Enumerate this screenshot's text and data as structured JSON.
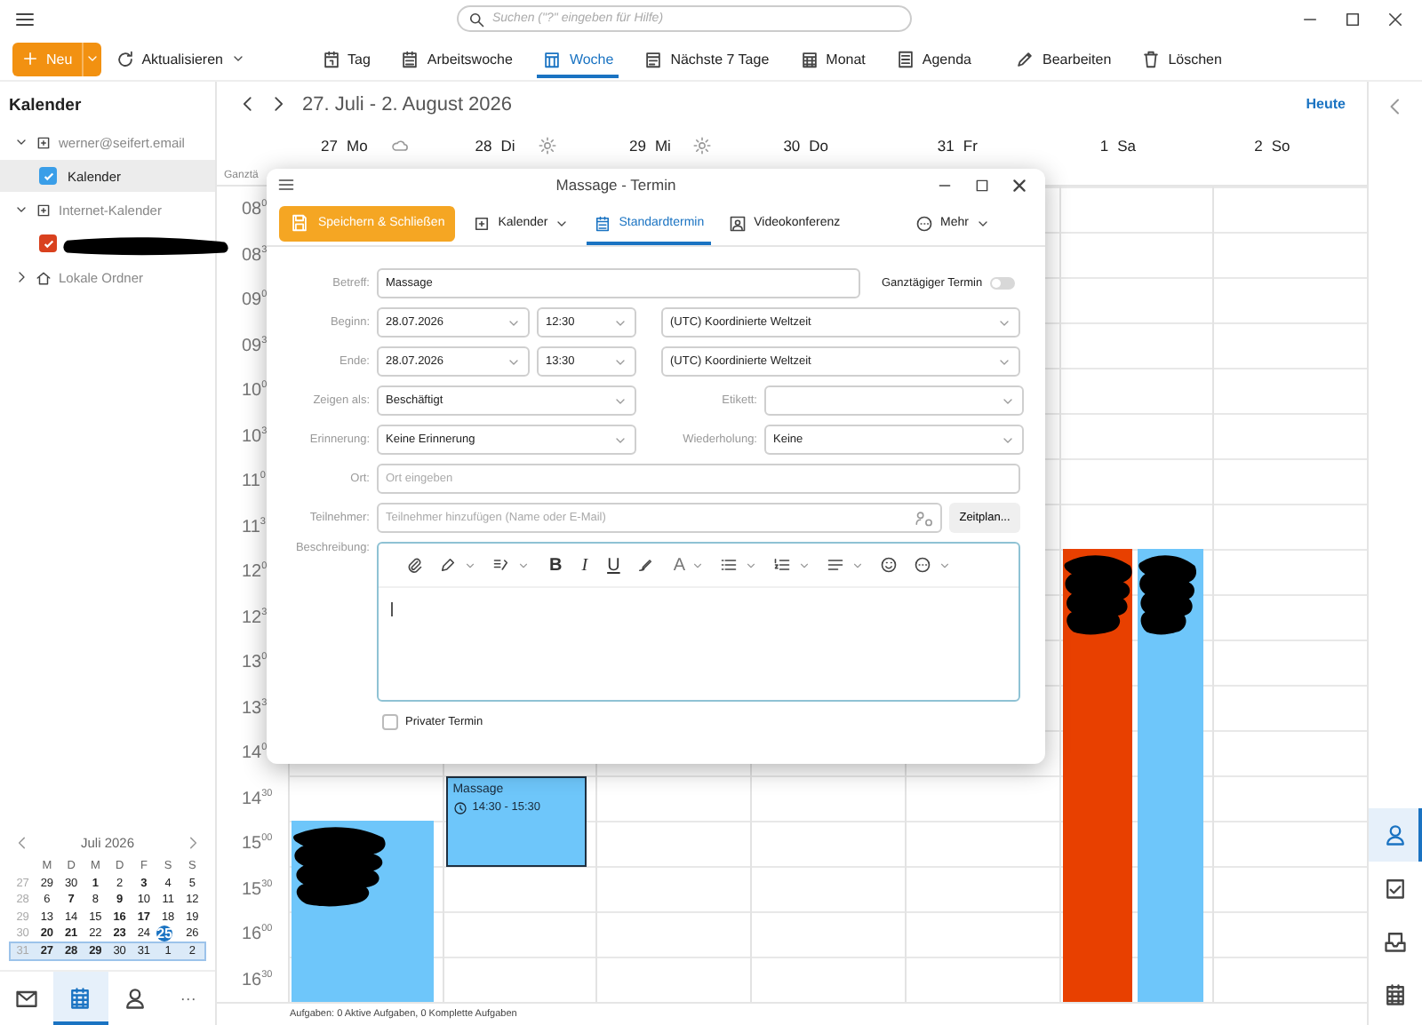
{
  "search": {
    "placeholder": "Suchen (\"?\" eingeben für Hilfe)"
  },
  "toolbar": {
    "new_button": "Neu",
    "refresh": "Aktualisieren",
    "views": [
      {
        "label": "Tag",
        "kind": "day",
        "selected": false
      },
      {
        "label": "Arbeitswoche",
        "kind": "workweek",
        "selected": false
      },
      {
        "label": "Woche",
        "kind": "week",
        "selected": true
      },
      {
        "label": "Nächste 7 Tage",
        "kind": "next7",
        "selected": false
      },
      {
        "label": "Monat",
        "kind": "month",
        "selected": false
      },
      {
        "label": "Agenda",
        "kind": "agenda",
        "selected": false
      }
    ],
    "actions": [
      {
        "label": "Bearbeiten",
        "kind": "edit"
      },
      {
        "label": "Löschen",
        "kind": "delete"
      }
    ]
  },
  "sidebar": {
    "title": "Kalender",
    "tree": [
      {
        "label": "werner@seifert.email",
        "kind": "account",
        "expanded": true,
        "children": [
          {
            "label": "Kalender",
            "checked": true,
            "selected": true,
            "color": "#3a9ee8"
          }
        ]
      },
      {
        "label": "Internet-Kalender",
        "kind": "account",
        "expanded": true,
        "children": [
          {
            "checked": true,
            "selected": false,
            "color": "#d9411e",
            "redacted": true
          }
        ]
      },
      {
        "label": "Lokale Ordner",
        "kind": "local",
        "expanded": false
      }
    ]
  },
  "minical": {
    "month": "Juli 2026",
    "weekdays": [
      "M",
      "D",
      "M",
      "D",
      "F",
      "S",
      "S"
    ],
    "weeks": [
      {
        "week": "27",
        "selected": false,
        "days": [
          {
            "d": "29",
            "bold": false,
            "today": false
          },
          {
            "d": "30",
            "bold": false,
            "today": false
          },
          {
            "d": "1",
            "bold": true,
            "today": false
          },
          {
            "d": "2",
            "bold": false,
            "today": false
          },
          {
            "d": "3",
            "bold": true,
            "today": false
          },
          {
            "d": "4",
            "bold": false,
            "today": false
          },
          {
            "d": "5",
            "bold": false,
            "today": false
          }
        ]
      },
      {
        "week": "28",
        "selected": false,
        "days": [
          {
            "d": "6",
            "bold": false,
            "today": false
          },
          {
            "d": "7",
            "bold": true,
            "today": false
          },
          {
            "d": "8",
            "bold": false,
            "today": false
          },
          {
            "d": "9",
            "bold": true,
            "today": false
          },
          {
            "d": "10",
            "bold": false,
            "today": false
          },
          {
            "d": "11",
            "bold": false,
            "today": false
          },
          {
            "d": "12",
            "bold": false,
            "today": false
          }
        ]
      },
      {
        "week": "29",
        "selected": false,
        "days": [
          {
            "d": "13",
            "bold": false,
            "today": false
          },
          {
            "d": "14",
            "bold": false,
            "today": false
          },
          {
            "d": "15",
            "bold": false,
            "today": false
          },
          {
            "d": "16",
            "bold": true,
            "today": false
          },
          {
            "d": "17",
            "bold": true,
            "today": false
          },
          {
            "d": "18",
            "bold": false,
            "today": false
          },
          {
            "d": "19",
            "bold": false,
            "today": false
          }
        ]
      },
      {
        "week": "30",
        "selected": false,
        "days": [
          {
            "d": "20",
            "bold": true,
            "today": false
          },
          {
            "d": "21",
            "bold": true,
            "today": false
          },
          {
            "d": "22",
            "bold": false,
            "today": false
          },
          {
            "d": "23",
            "bold": true,
            "today": false
          },
          {
            "d": "24",
            "bold": false,
            "today": false
          },
          {
            "d": "25",
            "bold": false,
            "today": true
          },
          {
            "d": "26",
            "bold": false,
            "today": false
          }
        ]
      },
      {
        "week": "31",
        "selected": true,
        "days": [
          {
            "d": "27",
            "bold": true,
            "today": false
          },
          {
            "d": "28",
            "bold": true,
            "today": false
          },
          {
            "d": "29",
            "bold": true,
            "today": false
          },
          {
            "d": "30",
            "bold": false,
            "today": false
          },
          {
            "d": "31",
            "bold": false,
            "today": false
          },
          {
            "d": "1",
            "bold": false,
            "today": false
          },
          {
            "d": "2",
            "bold": false,
            "today": false
          }
        ]
      }
    ]
  },
  "bottom_nav": [
    {
      "kind": "mail",
      "selected": false
    },
    {
      "kind": "calendar",
      "selected": true
    },
    {
      "kind": "contacts",
      "selected": false
    },
    {
      "kind": "more",
      "label": "···",
      "selected": false
    }
  ],
  "calendar": {
    "range": "27. Juli - 2. August 2026",
    "today_button": "Heute",
    "allday_label": "Ganztä",
    "days": [
      {
        "num": "27",
        "name": "Mo",
        "weather": {
          "kind": "cloud"
        },
        "events": [
          {
            "kind": "full",
            "color": "#6ec6fa",
            "selected": false,
            "redacted": true
          }
        ]
      },
      {
        "num": "28",
        "name": "Di",
        "weather": {
          "kind": "sun"
        },
        "events": [
          {
            "title": "Massage",
            "time": "14:30 - 15:30",
            "kind": "full",
            "color": "#6ec6fa",
            "selected": true
          }
        ]
      },
      {
        "num": "29",
        "name": "Mi",
        "weather": {
          "kind": "sun"
        }
      },
      {
        "num": "30",
        "name": "Do"
      },
      {
        "num": "31",
        "name": "Fr"
      },
      {
        "num": "1",
        "name": "Sa",
        "events": [
          {
            "kind": "left",
            "color": "#e84000",
            "selected": false,
            "redacted": true
          },
          {
            "kind": "right",
            "color": "#6ec6fa",
            "selected": false,
            "redacted": true
          }
        ]
      },
      {
        "num": "2",
        "name": "So"
      }
    ],
    "times": [
      {
        "hour": "08",
        "minute": "0"
      },
      {
        "hour": "08",
        "minute": "3"
      },
      {
        "hour": "09",
        "minute": "0"
      },
      {
        "hour": "09",
        "minute": "3"
      },
      {
        "hour": "10",
        "minute": "0"
      },
      {
        "hour": "10",
        "minute": "3"
      },
      {
        "hour": "11",
        "minute": "0"
      },
      {
        "hour": "11",
        "minute": "3"
      },
      {
        "hour": "12",
        "minute": "0"
      },
      {
        "hour": "12",
        "minute": "3"
      },
      {
        "hour": "13",
        "minute": "0"
      },
      {
        "hour": "13",
        "minute": "3"
      },
      {
        "hour": "14",
        "minute": "0"
      },
      {
        "hour": "14",
        "minute": "30"
      },
      {
        "hour": "15",
        "minute": "00"
      },
      {
        "hour": "15",
        "minute": "30"
      },
      {
        "hour": "16",
        "minute": "00"
      },
      {
        "hour": "16",
        "minute": "30"
      }
    ]
  },
  "status_bar": "Aufgaben: 0 Aktive Aufgaben, 0 Komplette Aufgaben",
  "rail": [
    {
      "kind": "contacts",
      "selected": true
    },
    {
      "kind": "tasks",
      "selected": false
    },
    {
      "kind": "inbox",
      "selected": false
    },
    {
      "kind": "calendar",
      "selected": false
    }
  ],
  "dialog": {
    "title": "Massage - Termin",
    "save": "Speichern & Schließen",
    "calendar_menu": "Kalender",
    "tabs": [
      {
        "label": "Standardtermin",
        "kind": "standard",
        "selected": true
      },
      {
        "label": "Videokonferenz",
        "kind": "video",
        "selected": false
      }
    ],
    "more": "Mehr",
    "subject": {
      "label": "Betreff:",
      "value": "Massage"
    },
    "allday": {
      "label": "Ganztägiger Termin",
      "on": false
    },
    "start": {
      "label": "Beginn:",
      "date": "28.07.2026",
      "time": "12:30",
      "tz": "(UTC) Koordinierte Weltzeit"
    },
    "end": {
      "label": "Ende:",
      "date": "28.07.2026",
      "time": "13:30",
      "tz": "(UTC) Koordinierte Weltzeit"
    },
    "show_as": {
      "label": "Zeigen als:",
      "value": "Beschäftigt"
    },
    "tag": {
      "label": "Etikett:"
    },
    "reminder": {
      "label": "Erinnerung:",
      "value": "Keine Erinnerung"
    },
    "repeat": {
      "label": "Wiederholung:",
      "value": "Keine"
    },
    "location": {
      "label": "Ort:",
      "placeholder": "Ort eingeben"
    },
    "attendees": {
      "label": "Teilnehmer:",
      "placeholder": "Teilnehmer hinzufügen (Name oder E-Mail)"
    },
    "schedule_button": "Zeitplan...",
    "description": {
      "label": "Beschreibung:"
    },
    "editor_letters": [
      "B",
      "I",
      "U",
      "A"
    ],
    "private": {
      "label": "Privater Termin",
      "checked": false
    }
  }
}
